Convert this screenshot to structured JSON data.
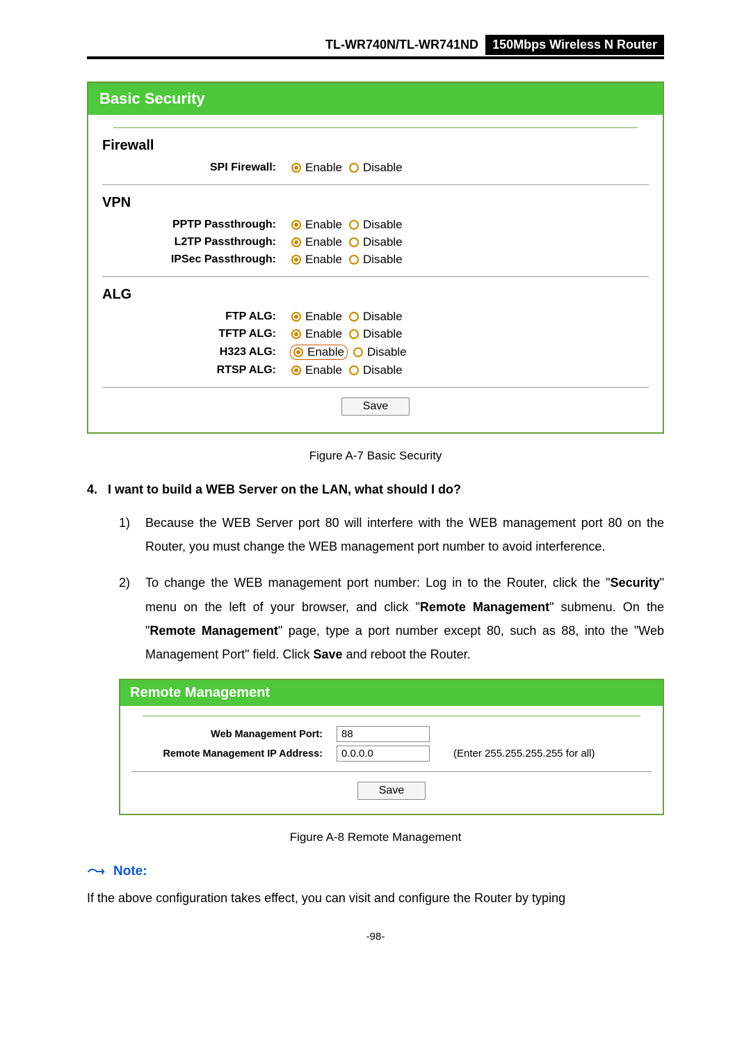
{
  "header": {
    "model": "TL-WR740N/TL-WR741ND",
    "desc": "150Mbps Wireless N Router"
  },
  "basic_security": {
    "panel_title": "Basic Security",
    "firewall": {
      "heading": "Firewall",
      "spi_label": "SPI Firewall:",
      "enable": "Enable",
      "disable": "Disable",
      "spi_value": "enable"
    },
    "vpn": {
      "heading": "VPN",
      "pptp_label": "PPTP Passthrough:",
      "l2tp_label": "L2TP Passthrough:",
      "ipsec_label": "IPSec Passthrough:",
      "enable": "Enable",
      "disable": "Disable",
      "pptp_value": "enable",
      "l2tp_value": "enable",
      "ipsec_value": "enable"
    },
    "alg": {
      "heading": "ALG",
      "ftp_label": "FTP ALG:",
      "tftp_label": "TFTP ALG:",
      "h323_label": "H323 ALG:",
      "rtsp_label": "RTSP ALG:",
      "enable": "Enable",
      "disable": "Disable",
      "ftp_value": "enable",
      "tftp_value": "enable",
      "h323_value": "enable",
      "rtsp_value": "enable"
    },
    "save": "Save"
  },
  "figure_a7": "Figure A-7    Basic Security",
  "question4": {
    "num": "4.",
    "text": "I want to build a WEB Server on the LAN, what should I do?"
  },
  "step1": "Because the WEB Server port 80 will interfere with the WEB management port 80 on the Router, you must change the WEB management port number to avoid interference.",
  "step2_pre": "To change the WEB management port number: Log in to the Router, click the \"",
  "step2_b1": "Security",
  "step2_mid1": "\" menu on the left of your browser, and click \"",
  "step2_b2": "Remote Management",
  "step2_mid2": "\" submenu. On the \"",
  "step2_b3": "Remote Management",
  "step2_mid3": "\" page, type a port number except 80, such as 88, into the \"Web Management Port\" field. Click ",
  "step2_b4": "Save",
  "step2_post": " and reboot the Router.",
  "remote": {
    "panel_title": "Remote Management",
    "port_label": "Web Management Port:",
    "port_value": "88",
    "ip_label": "Remote Management IP Address:",
    "ip_value": "0.0.0.0",
    "hint": "(Enter 255.255.255.255 for all)",
    "save": "Save"
  },
  "figure_a8": "Figure A-8    Remote Management",
  "note": {
    "heading": "Note:",
    "text": "If the above configuration takes effect, you can visit and configure the Router by typing"
  },
  "page_number": "-98-"
}
